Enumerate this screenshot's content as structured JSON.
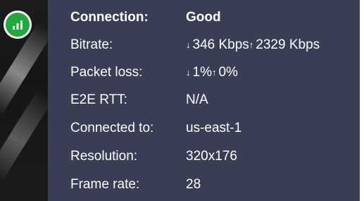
{
  "stats": {
    "connection": {
      "label": "Connection:",
      "value": "Good"
    },
    "bitrate": {
      "label": "Bitrate:",
      "down_arrow": "↓",
      "down": "346 Kbps",
      "up_arrow": "↑",
      "up": "2329 Kbps"
    },
    "packet_loss": {
      "label": "Packet loss:",
      "down_arrow": "↓",
      "down": "1%",
      "up_arrow": "↑",
      "up": "0%"
    },
    "rtt": {
      "label": "E2E RTT:",
      "value": "N/A"
    },
    "connected_to": {
      "label": "Connected to:",
      "value": "us-east-1"
    },
    "resolution": {
      "label": "Resolution:",
      "value": "320x176"
    },
    "frame_rate": {
      "label": "Frame rate:",
      "value": "28"
    }
  },
  "icons": {
    "signal": "signal-bars-icon"
  },
  "colors": {
    "panel_bg": "#3a3e55",
    "signal_good": "#1faa3a",
    "text": "#ffffff"
  }
}
